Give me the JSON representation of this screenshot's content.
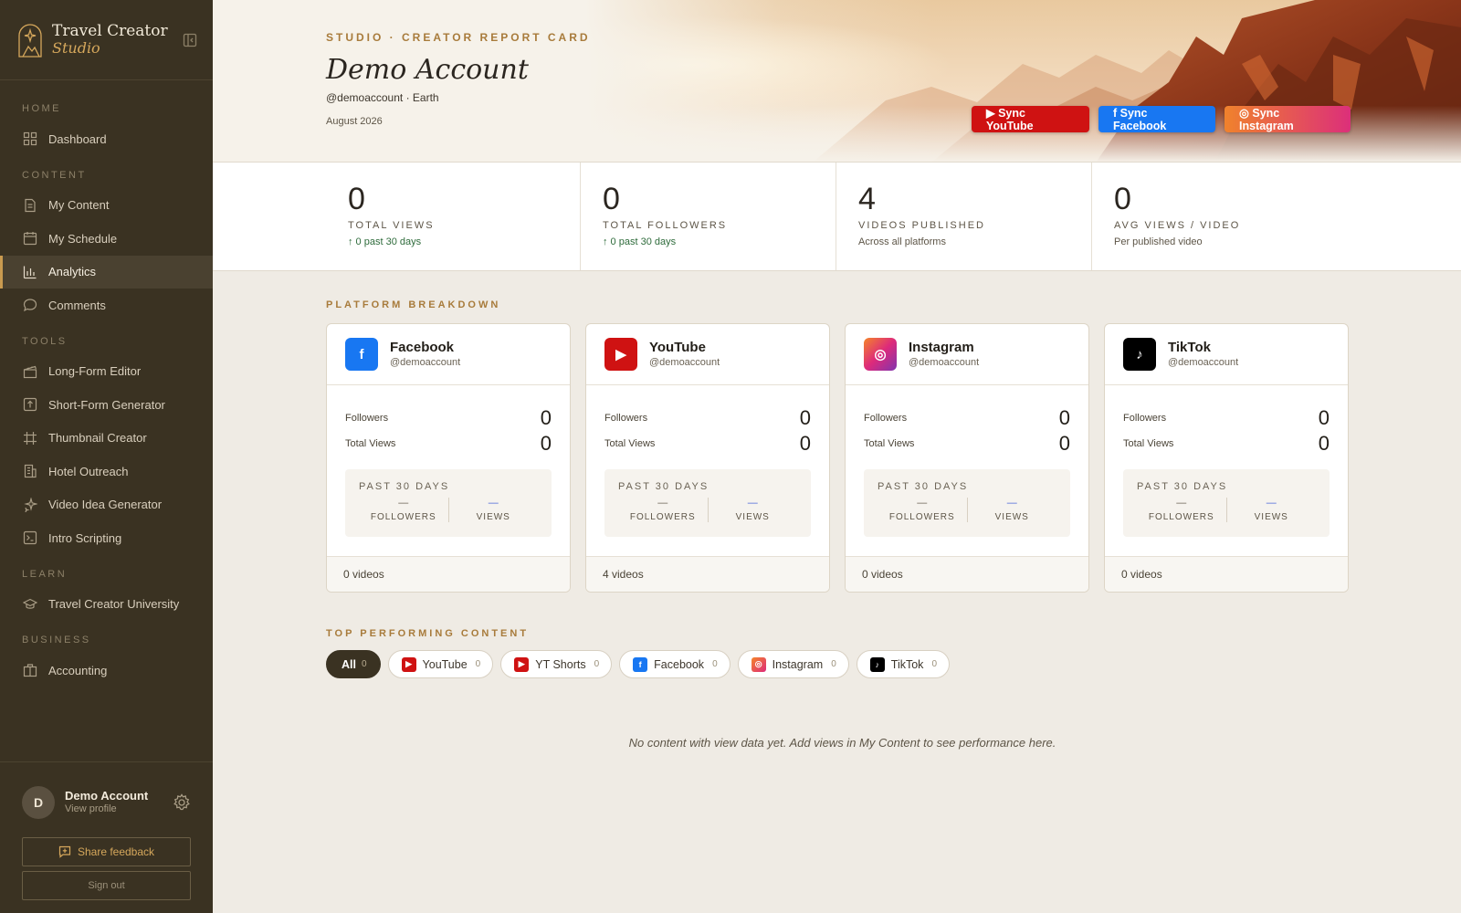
{
  "brand": {
    "title": "Travel Creator",
    "subtitle": "Studio"
  },
  "nav": {
    "home_section": "HOME",
    "dashboard": "Dashboard",
    "content_section": "CONTENT",
    "my_content": "My Content",
    "my_schedule": "My Schedule",
    "analytics": "Analytics",
    "comments": "Comments",
    "tools_section": "TOOLS",
    "long_form": "Long-Form Editor",
    "short_form": "Short-Form Generator",
    "thumbnail": "Thumbnail Creator",
    "hotel": "Hotel Outreach",
    "video_idea": "Video Idea Generator",
    "intro": "Intro Scripting",
    "learn_section": "LEARN",
    "university": "Travel Creator University",
    "business_section": "BUSINESS",
    "accounting": "Accounting"
  },
  "user": {
    "initial": "D",
    "name": "Demo Account",
    "link": "View profile",
    "feedback": "Share feedback",
    "signout": "Sign out"
  },
  "hero": {
    "kicker": "STUDIO · CREATOR REPORT CARD",
    "name": "Demo Account",
    "handle": "@demoaccount · Earth",
    "period": "August 2026",
    "sync_youtube": "▶ Sync YouTube",
    "sync_facebook": "f Sync Facebook",
    "sync_instagram": "◎ Sync Instagram"
  },
  "stats": [
    {
      "value": "0",
      "label": "TOTAL VIEWS",
      "sub": "↑ 0 past 30 days"
    },
    {
      "value": "0",
      "label": "TOTAL FOLLOWERS",
      "sub": "↑ 0 past 30 days"
    },
    {
      "value": "4",
      "label": "VIDEOS PUBLISHED",
      "sub": "Across all platforms"
    },
    {
      "value": "0",
      "label": "AVG VIEWS / VIDEO",
      "sub": "Per published video"
    }
  ],
  "breakdown": {
    "title": "PLATFORM BREAKDOWN",
    "followers_label": "Followers",
    "views_label": "Total Views",
    "past_title": "PAST 30 DAYS",
    "past_followers": "FOLLOWERS",
    "past_views": "VIEWS",
    "dash": "—",
    "platforms": [
      {
        "name": "Facebook",
        "handle": "@demoaccount",
        "glyph": "f",
        "color": "#1877f2",
        "followers": "0",
        "views": "0",
        "videos": "0 videos"
      },
      {
        "name": "YouTube",
        "handle": "@demoaccount",
        "glyph": "▶",
        "color": "#cf1212",
        "followers": "0",
        "views": "0",
        "videos": "4 videos"
      },
      {
        "name": "Instagram",
        "handle": "@demoaccount",
        "glyph": "◎",
        "color": "#e1306c",
        "followers": "0",
        "views": "0",
        "videos": "0 videos"
      },
      {
        "name": "TikTok",
        "handle": "@demoaccount",
        "glyph": "♪",
        "color": "#000000",
        "followers": "0",
        "views": "0",
        "videos": "0 videos"
      }
    ]
  },
  "top": {
    "title": "TOP PERFORMING CONTENT",
    "filters": [
      {
        "label": "All",
        "count": "0"
      },
      {
        "label": "YouTube",
        "count": "0"
      },
      {
        "label": "YT Shorts",
        "count": "0"
      },
      {
        "label": "Facebook",
        "count": "0"
      },
      {
        "label": "Instagram",
        "count": "0"
      },
      {
        "label": "TikTok",
        "count": "0"
      }
    ],
    "empty": "No content with view data yet. Add views in My Content to see performance here."
  }
}
